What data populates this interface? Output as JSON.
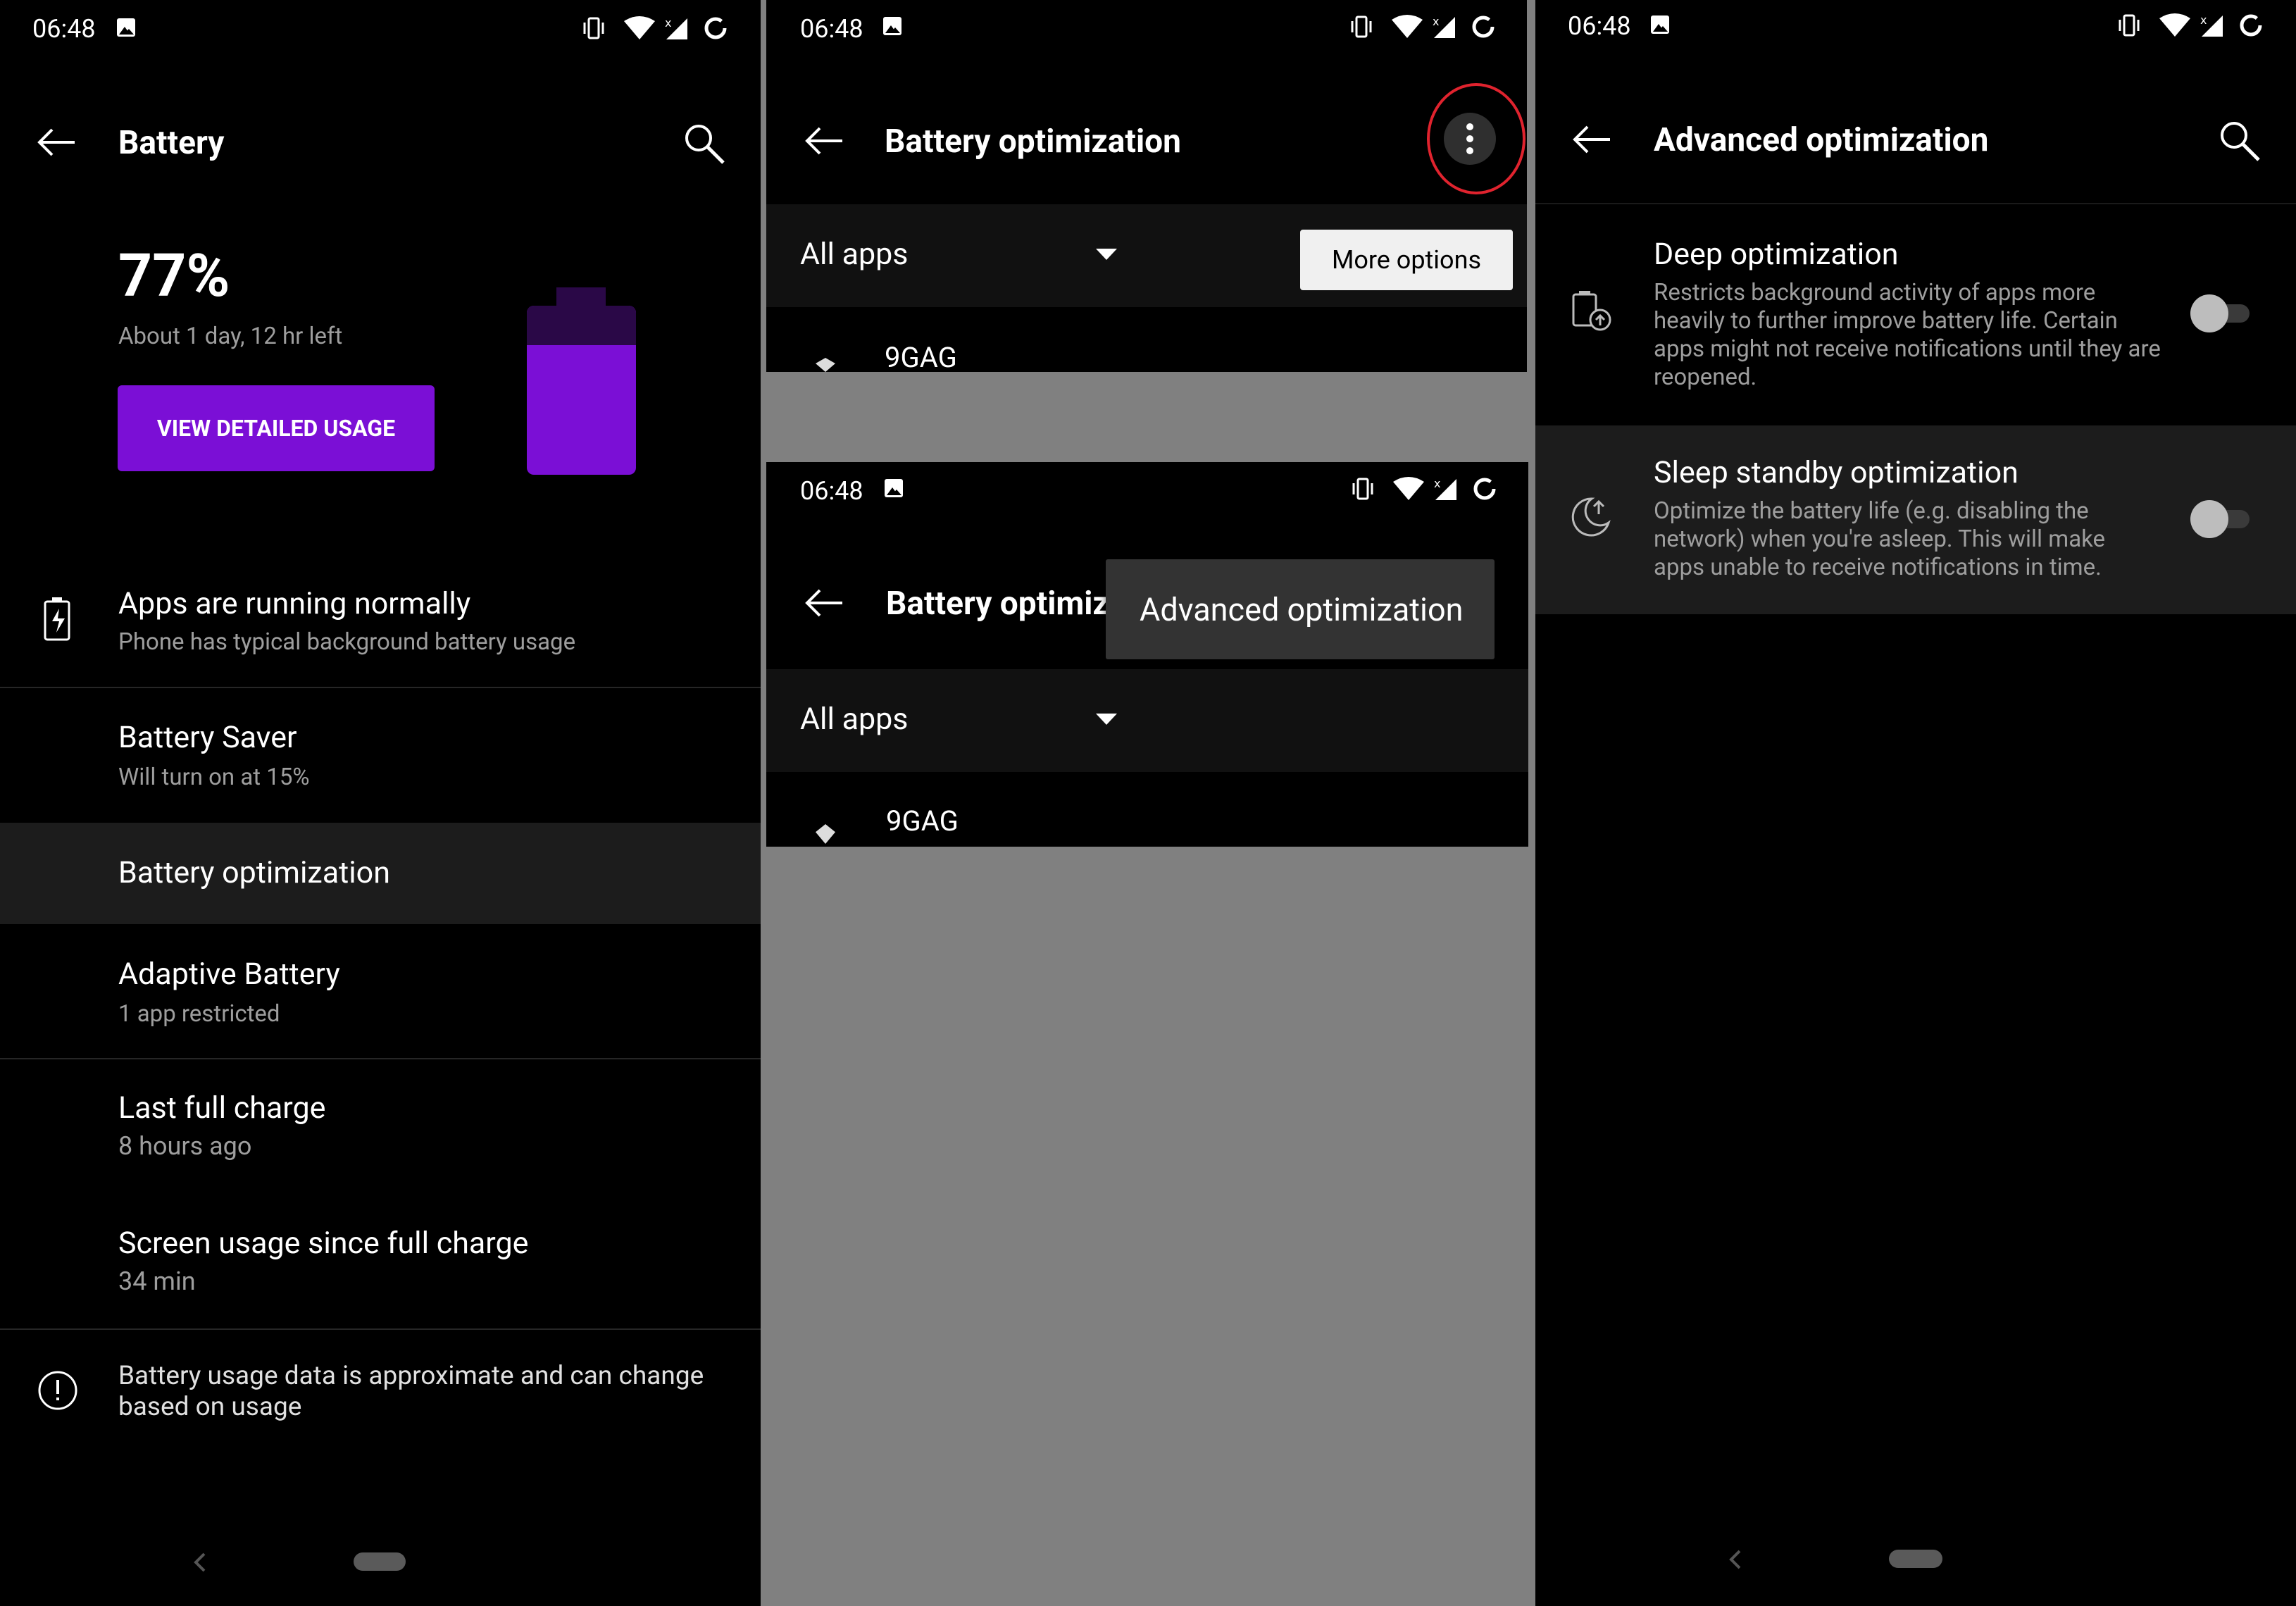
{
  "status_bar": {
    "time": "06:48"
  },
  "panel1": {
    "title": "Battery",
    "percent": "77%",
    "time_left": "About 1 day, 12 hr left",
    "detail_button": "VIEW DETAILED USAGE",
    "battery_level": 0.77,
    "accent": "#7b0fd6",
    "rows": [
      {
        "title": "Apps are running normally",
        "subtitle": "Phone has typical background battery usage"
      },
      {
        "title": "Battery Saver",
        "subtitle": "Will turn on at 15%"
      },
      {
        "title": "Battery optimization",
        "subtitle": ""
      },
      {
        "title": "Adaptive Battery",
        "subtitle": "1 app restricted"
      },
      {
        "title": "Last full charge",
        "subtitle": "8 hours ago"
      },
      {
        "title": "Screen usage since full charge",
        "subtitle": "34 min"
      }
    ],
    "footer_note": "Battery usage data is approximate and can change based on usage"
  },
  "panel2": {
    "title": "Battery optimization",
    "filter": "All apps",
    "more_options": "More options",
    "app": "9GAG"
  },
  "panel2b": {
    "title": "Battery optimiz",
    "filter": "All apps",
    "menu_item": "Advanced optimization",
    "app": "9GAG"
  },
  "panel3": {
    "title": "Advanced optimization",
    "rows": [
      {
        "title": "Deep optimization",
        "subtitle": "Restricts background activity of apps more heavily to further improve battery life. Certain apps might not receive notifications until they are reopened.",
        "enabled": false
      },
      {
        "title": "Sleep standby optimization",
        "subtitle": "Optimize the battery life (e.g. disabling the network) when you're asleep. This will make apps unable to receive notifications in time.",
        "enabled": false
      }
    ]
  },
  "colors": {
    "highlight_circle": "#e0232e",
    "row_highlight": "#1c1c1c",
    "toggle_off": "#bdbdbd"
  }
}
